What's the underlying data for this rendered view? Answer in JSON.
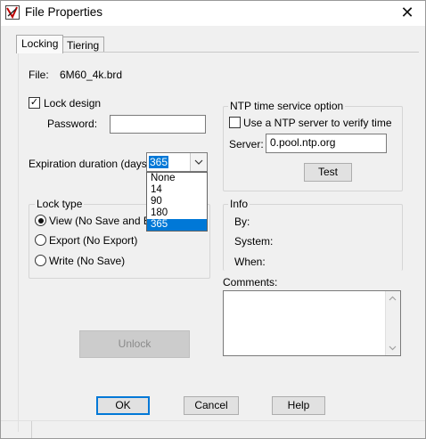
{
  "window": {
    "title": "File Properties"
  },
  "tabs": [
    {
      "label": "Locking"
    },
    {
      "label": "Tiering"
    }
  ],
  "file": {
    "label": "File:",
    "value": "6M60_4k.brd"
  },
  "lock_design": {
    "label": "Lock design",
    "checked": true
  },
  "password": {
    "label": "Password:",
    "value": ""
  },
  "expiration": {
    "label": "Expiration duration (days):",
    "selected": "365",
    "options": [
      "None",
      "14",
      "90",
      "180",
      "365"
    ]
  },
  "lock_type": {
    "legend": "Lock type",
    "options": [
      {
        "label": "View (No Save and Exp",
        "selected": true
      },
      {
        "label": "Export (No Export)",
        "selected": false
      },
      {
        "label": "Write (No Save)",
        "selected": false
      }
    ]
  },
  "ntp": {
    "legend": "NTP time service option",
    "use_label": "Use a NTP server to verify time",
    "use_checked": false,
    "server_label": "Server:",
    "server_value": "0.pool.ntp.org",
    "test_label": "Test"
  },
  "info": {
    "legend": "Info",
    "by_label": "By:",
    "system_label": "System:",
    "when_label": "When:"
  },
  "comments": {
    "label": "Comments:",
    "value": ""
  },
  "buttons": {
    "unlock": "Unlock",
    "ok": "OK",
    "cancel": "Cancel",
    "help": "Help"
  },
  "colors": {
    "selection": "#0078d7",
    "dialog_bg": "#f0f0f0"
  }
}
